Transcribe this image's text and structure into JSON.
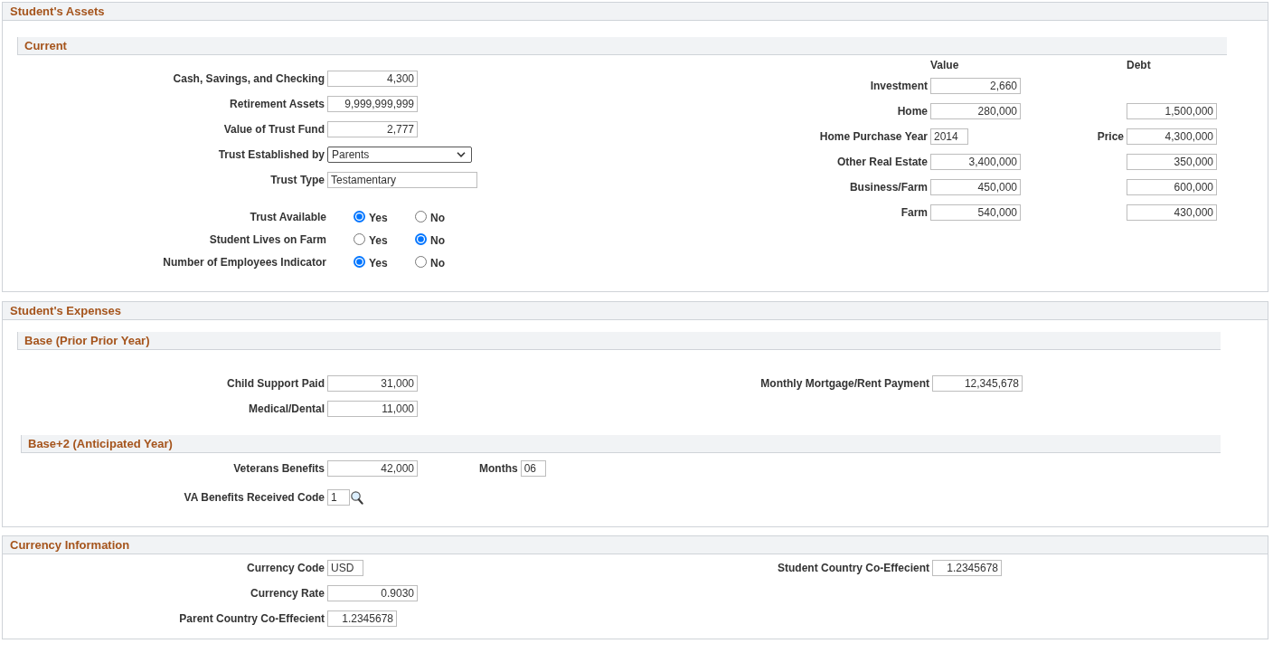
{
  "assets": {
    "title": "Student's Assets",
    "subtitle": "Current",
    "fields": [
      {
        "label": "Cash, Savings, and Checking",
        "kind": "amount",
        "value": "4,300"
      },
      {
        "label": "Retirement Assets",
        "kind": "amount",
        "value": "9,999,999,999"
      },
      {
        "label": "Value of Trust Fund",
        "kind": "amount",
        "value": "2,777"
      },
      {
        "label": "Trust Established by",
        "kind": "dropdown",
        "value": "Parents"
      },
      {
        "label": "Trust Type",
        "kind": "text",
        "value": "Testamentary"
      }
    ],
    "radio_groups": [
      {
        "label": "Trust Available",
        "options": [
          {
            "label": "Yes",
            "selected": true
          },
          {
            "label": "No",
            "selected": false
          }
        ]
      },
      {
        "label": "Student Lives on Farm",
        "options": [
          {
            "label": "Yes",
            "selected": false
          },
          {
            "label": "No",
            "selected": true
          }
        ]
      },
      {
        "label": "Number of Employees Indicator",
        "options": [
          {
            "label": "Yes",
            "selected": true
          },
          {
            "label": "No",
            "selected": false
          }
        ]
      }
    ],
    "value_header": "Value",
    "debt_header": "Debt",
    "holdings": [
      {
        "label": "Investment",
        "kind": "amount",
        "value": "2,660"
      },
      {
        "label": "Home",
        "kind": "amount",
        "value": "280,000",
        "debt": "1,500,000"
      },
      {
        "label": "Home Purchase Year",
        "kind": "code",
        "value": "2014",
        "debt_label": "Price",
        "debt": "4,300,000"
      },
      {
        "label": "Other Real Estate",
        "kind": "amount",
        "value": "3,400,000",
        "debt": "350,000"
      },
      {
        "label": "Business/Farm",
        "kind": "amount",
        "value": "450,000",
        "debt": "600,000"
      },
      {
        "label": "Farm",
        "kind": "amount",
        "value": "540,000",
        "debt": "430,000"
      }
    ]
  },
  "expenses": {
    "title": "Student's Expenses",
    "base": {
      "title": "Base (Prior Prior Year)",
      "fields": [
        {
          "label": "Child Support Paid",
          "kind": "amount",
          "value": "31,000"
        },
        {
          "label": "Medical/Dental",
          "kind": "amount",
          "value": "11,000"
        }
      ],
      "right_fields": [
        {
          "label": "Monthly Mortgage/Rent Payment",
          "kind": "amount",
          "value": "12,345,678"
        }
      ]
    },
    "anticipated": {
      "title": "Base+2 (Anticipated Year)",
      "fields": [
        {
          "label": "Veterans Benefits",
          "kind": "amount",
          "value": "42,000",
          "extra": {
            "label": "Months",
            "kind": "code",
            "value": "06"
          }
        },
        {
          "label": "VA Benefits Received Code",
          "kind": "lookup",
          "value": "1"
        }
      ]
    }
  },
  "currency": {
    "title": "Currency Information",
    "fields": [
      {
        "label": "Currency Code",
        "kind": "code",
        "value": "USD"
      },
      {
        "label": "Currency Rate",
        "kind": "amount",
        "value": "0.9030"
      },
      {
        "label": "Parent Country Co-Effecient",
        "kind": "ratio",
        "value": "1.2345678"
      }
    ],
    "right_fields": [
      {
        "label": "Student Country Co-Effecient",
        "kind": "ratio",
        "value": "1.2345678"
      }
    ]
  }
}
